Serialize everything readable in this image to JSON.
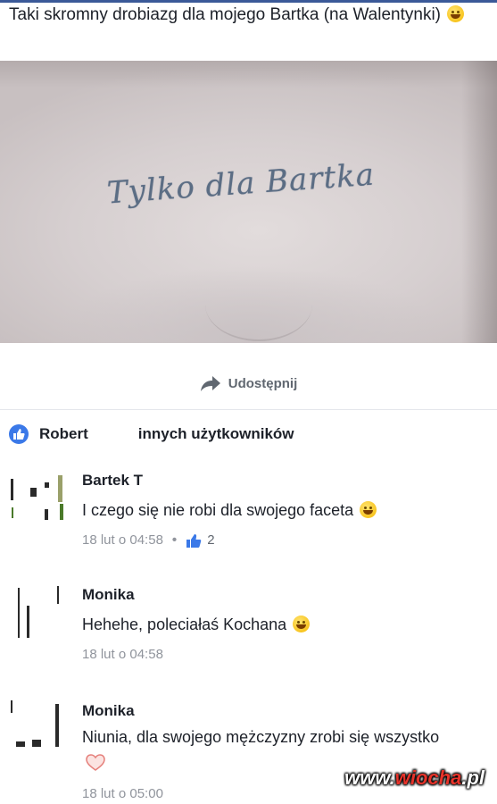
{
  "post": {
    "text": "Taki skromny drobiazg dla mojego Bartka (na Walentynki)",
    "emoji": "smiling-face-emoji",
    "photo_text": "Tylko dla Bartka"
  },
  "actions": {
    "share_label": "Udostępnij"
  },
  "reactions": {
    "first_name": "Robert",
    "others_text": "innych użytkowników"
  },
  "comments": [
    {
      "author": "Bartek T",
      "text": "I czego się nie robi dla swojego faceta",
      "time": "18 lut o 04:58",
      "likes": "2"
    },
    {
      "author": "Monika",
      "text": "Hehehe, poleciałaś Kochana",
      "time": "18 lut o 04:58"
    },
    {
      "author": "Monika",
      "text": "Niunia, dla swojego mężczyzny zrobi się wszystko",
      "time": "18 lut o 05:00"
    }
  ],
  "watermark": {
    "prefix": "www.",
    "brand": "wiocha",
    "suffix": ".pl"
  },
  "colors": {
    "facebook_blue": "#3b5998",
    "like_blue": "#3b79e8",
    "meta_gray": "#90949c",
    "watermark_red": "#e8332a"
  }
}
